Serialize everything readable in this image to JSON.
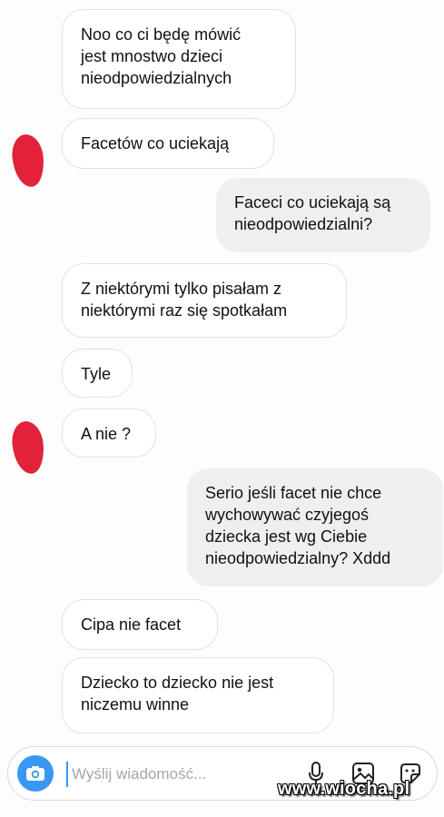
{
  "conversation": {
    "messages": [
      {
        "side": "incoming",
        "text": "Noo co ci będę mówić\njest mnostwo dzieci\nnieodpowiedzialnych"
      },
      {
        "side": "incoming",
        "text": "Facetów co uciekają"
      },
      {
        "side": "outgoing",
        "text": "Faceci co uciekają są\nnieodpowiedzialni?"
      },
      {
        "side": "incoming",
        "text": "Z niektórymi tylko pisałam z\nniektórymi raz się spotkałam"
      },
      {
        "side": "incoming",
        "text": "Tyle"
      },
      {
        "side": "incoming",
        "text": "A nie ?"
      },
      {
        "side": "outgoing",
        "text": "Serio jeśli facet nie chce\nwychowywać czyjegoś\ndziecka jest wg Ciebie\nnieodpowiedzialny? Xddd"
      },
      {
        "side": "incoming",
        "text": "Cipa nie facet"
      },
      {
        "side": "incoming",
        "text": "Dziecko to dziecko nie jest\nniczemu winne"
      }
    ]
  },
  "composer": {
    "placeholder": "Wyślij wiadomość...",
    "icons": [
      "camera-icon",
      "microphone-icon",
      "gallery-icon",
      "sticker-icon"
    ],
    "accent_color": "#3897f0"
  },
  "watermark": {
    "text": "www.wiocha.pl"
  },
  "colors": {
    "incoming_bubble": "#ffffff",
    "outgoing_bubble": "#efefef",
    "avatar_censor": "#e2223a"
  }
}
